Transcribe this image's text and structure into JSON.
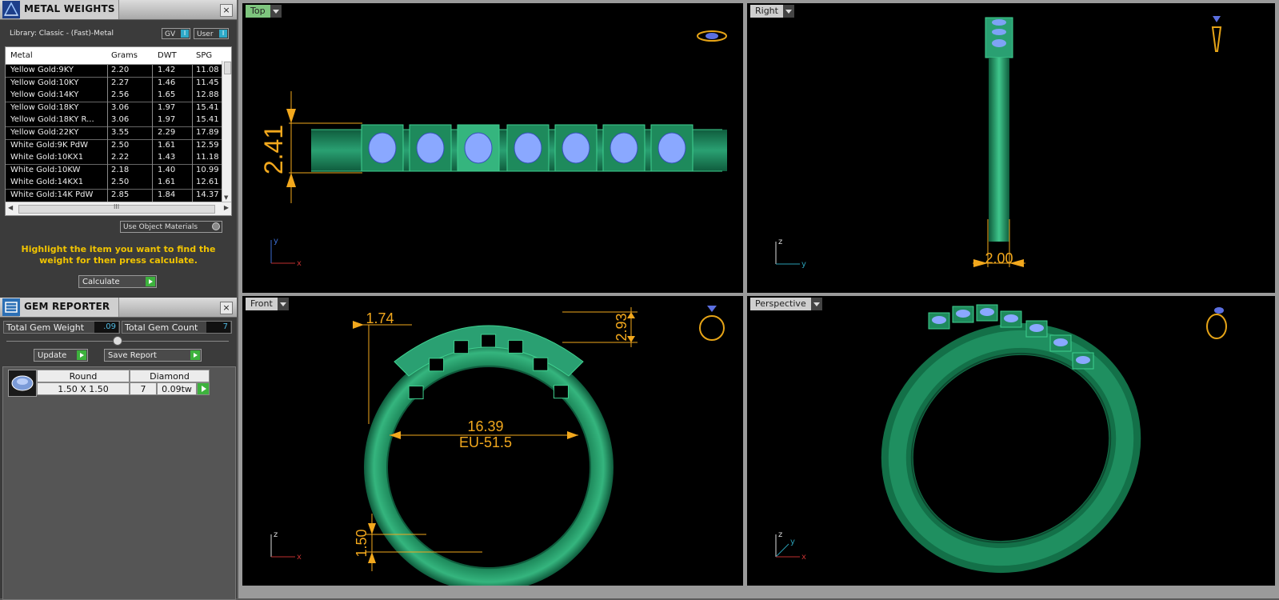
{
  "metal_weights": {
    "title": "METAL WEIGHTS",
    "close": "×",
    "library": "Library: Classic - (Fast)-Metal",
    "gv": "GV",
    "user": "User",
    "toggle": "I",
    "columns": [
      "Metal",
      "Grams",
      "DWT",
      "SPG"
    ],
    "rows": [
      {
        "metal": "Yellow Gold:9KY",
        "grams": "2.20",
        "dwt": "1.42",
        "spg": "11.08"
      },
      {
        "metal": "Yellow Gold:10KY",
        "grams": "2.27",
        "dwt": "1.46",
        "spg": "11.45"
      },
      {
        "metal": "Yellow Gold:14KY",
        "grams": "2.56",
        "dwt": "1.65",
        "spg": "12.88"
      },
      {
        "metal": "Yellow Gold:18KY",
        "grams": "3.06",
        "dwt": "1.97",
        "spg": "15.41"
      },
      {
        "metal": "Yellow Gold:18KY R...",
        "grams": "3.06",
        "dwt": "1.97",
        "spg": "15.41"
      },
      {
        "metal": "Yellow Gold:22KY",
        "grams": "3.55",
        "dwt": "2.29",
        "spg": "17.89"
      },
      {
        "metal": "White Gold:9K PdW",
        "grams": "2.50",
        "dwt": "1.61",
        "spg": "12.59"
      },
      {
        "metal": "White Gold:10KX1",
        "grams": "2.22",
        "dwt": "1.43",
        "spg": "11.18"
      },
      {
        "metal": "White Gold:10KW",
        "grams": "2.18",
        "dwt": "1.40",
        "spg": "10.99"
      },
      {
        "metal": "White Gold:14KX1",
        "grams": "2.50",
        "dwt": "1.61",
        "spg": "12.61"
      },
      {
        "metal": "White Gold:14K PdW",
        "grams": "2.85",
        "dwt": "1.84",
        "spg": "14.37"
      }
    ],
    "scroll_grip": "III",
    "use_object_materials": "Use Object Materials",
    "hint": "Highlight the item you want to find the weight for then press calculate.",
    "calculate": "Calculate"
  },
  "gem_reporter": {
    "title": "GEM REPORTER",
    "close": "×",
    "total_weight_label": "Total Gem Weight",
    "total_weight": ".09",
    "total_count_label": "Total Gem Count",
    "total_count": "7",
    "update": "Update",
    "save_report": "Save Report",
    "gem": {
      "shape": "Round",
      "material": "Diamond",
      "size": "1.50 X 1.50",
      "count": "7",
      "weight": "0.09tw"
    }
  },
  "viewports": {
    "top": {
      "label": "Top",
      "dim": "2.41"
    },
    "right": {
      "label": "Right",
      "dim": "2.00"
    },
    "front": {
      "label": "Front",
      "dims": [
        "1.74",
        "2.93",
        "16.39",
        "EU-51.5",
        "1.50"
      ]
    },
    "perspective": {
      "label": "Perspective"
    }
  },
  "axes": {
    "x": "x",
    "y": "y",
    "z": "z"
  },
  "colors": {
    "ring_green": "#1f8f60",
    "dimension": "#f2a81d",
    "gem_blue": "#8aa8ff",
    "active_tab": "#7ec57e"
  }
}
